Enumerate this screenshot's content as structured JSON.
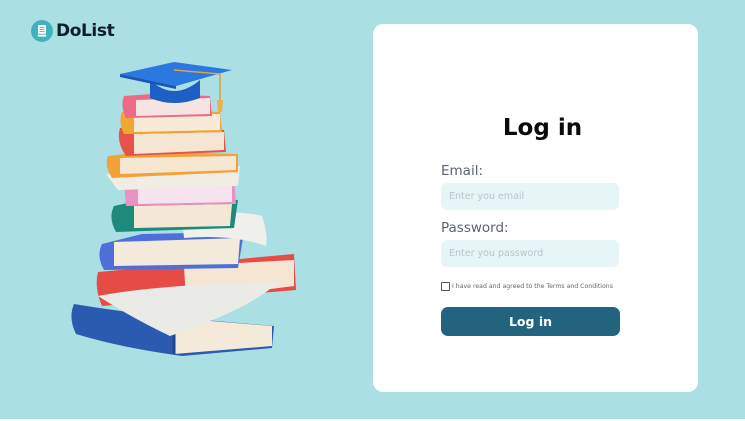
{
  "brand": {
    "name": "DoList",
    "icon": "notepad-icon",
    "color": "#0f1f2a"
  },
  "illustration": {
    "icon": "book-stack-graduation-cap-icon"
  },
  "login": {
    "title": "Log in",
    "email_label": "Email:",
    "email_placeholder": "Enter you email",
    "email_value": "",
    "password_label": "Password:",
    "password_placeholder": "Enter you password",
    "password_value": "",
    "terms_text": "I have read and agreed to the Terms and Conditions",
    "terms_checked": false,
    "submit_label": "Log in"
  },
  "colors": {
    "background": "#aadfe3",
    "card": "#ffffff",
    "input_background": "#e8f5f7",
    "button": "#226480",
    "button_text": "#ffffff"
  }
}
